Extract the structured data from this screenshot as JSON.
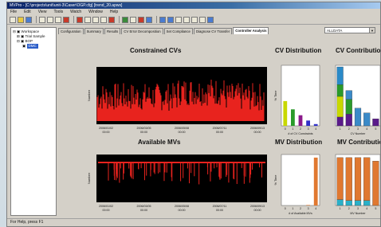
{
  "window": {
    "title": "MVPro - [C:\\projects\\unit\\unit-3\\Caser\\OGP.cfg] [trend_20.apws]"
  },
  "menu": [
    "File",
    "Edit",
    "View",
    "Tools",
    "Watch",
    "Window",
    "Help"
  ],
  "tree": {
    "root": "Workspace",
    "items": [
      "Trial Sample",
      "BOP"
    ],
    "selected": "DMC"
  },
  "tabs": [
    "Configuration",
    "Summary",
    "Results",
    "CV Error Decomposition",
    "Set Compliance",
    "Diagnose CV Transfer",
    "Controller Analysis"
  ],
  "active_tab": "Controller Analysis",
  "dropdown": {
    "value": "ALLDATA"
  },
  "panels": {
    "constrained_cvs": {
      "title": "Constrained CVs",
      "ylabel": "Number",
      "x_ticks": [
        "2006/01/02\n00:00",
        "2006/03/05\n00:00",
        "2006/05/08\n00:00",
        "2006/07/11\n00:00",
        "2006/09/13\n00:00"
      ]
    },
    "available_mvs": {
      "title": "Available MVs",
      "ylabel": "Number",
      "x_ticks": [
        "2006/01/02\n00:00",
        "2006/03/05\n00:00",
        "2006/05/08\n00:00",
        "2006/07/11\n00:00",
        "2006/09/13\n00:00"
      ]
    },
    "cv_distribution": {
      "title": "CV Distribution",
      "ylabel": "% Time",
      "xlabel": "# of CV Constraints"
    },
    "mv_distribution": {
      "title": "MV Distribution",
      "ylabel": "% Time",
      "xlabel": "# of Available MVs"
    },
    "cv_contribution": {
      "title": "CV Contribution",
      "xlabel": "CV Number"
    },
    "mv_contribution": {
      "title": "MV Contribution",
      "xlabel": "MV Number"
    }
  },
  "chart_data": [
    {
      "type": "bar",
      "title": "CV Distribution",
      "categories": [
        "0",
        "1",
        "2",
        "3",
        "4"
      ],
      "values": [
        42,
        28,
        18,
        9,
        3
      ],
      "colors": [
        "#c8d800",
        "#2a9a2a",
        "#8a1a8a",
        "#3030c8",
        "#3030c8"
      ]
    },
    {
      "type": "bar",
      "title": "MV Distribution",
      "categories": [
        "0",
        "1",
        "2",
        "3",
        "4"
      ],
      "values": [
        0,
        0,
        0,
        1,
        97
      ],
      "colors": [
        "#e07830",
        "#e07830",
        "#e07830",
        "#e07830",
        "#e07830"
      ]
    }
  ],
  "status": {
    "text": "For Help, press F1"
  }
}
